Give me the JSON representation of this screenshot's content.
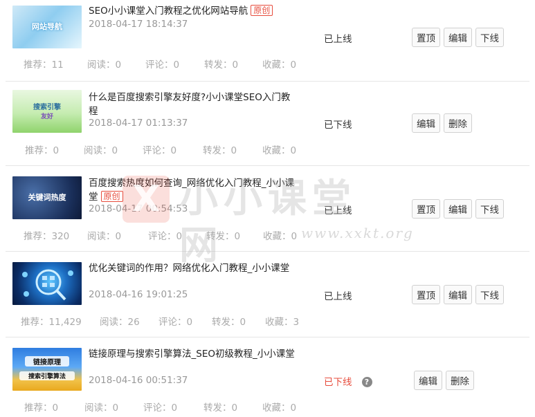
{
  "posts": [
    {
      "thumb_text": "网站导航",
      "title": "SEO小小课堂入门教程之优化网站导航",
      "tag": "原创",
      "date": "2018-04-17 18:14:37",
      "status": "已上线",
      "buttons": [
        "置顶",
        "编辑",
        "下线"
      ],
      "stats": {
        "recommend": "推荐：11",
        "read": "阅读：0",
        "comment": "评论：0",
        "share": "转发：0",
        "fav": "收藏：0"
      }
    },
    {
      "thumb_text": "搜索引擎",
      "thumb_sub": "友好",
      "title": "什么是百度搜索引擎友好度?小小课堂SEO入门教程",
      "tag": "",
      "date": "2018-04-17 01:13:37",
      "status": "已下线",
      "buttons": [
        "编辑",
        "删除"
      ],
      "stats": {
        "recommend": "推荐：0",
        "read": "阅读：0",
        "comment": "评论：0",
        "share": "转发：0",
        "fav": "收藏：0"
      }
    },
    {
      "thumb_text": "关键词热度",
      "title": "百度搜索热度如何查询_网络优化入门教程_小小课堂",
      "tag": "原创",
      "date": "2018-04-17 00:54:53",
      "status": "已上线",
      "buttons": [
        "置顶",
        "编辑",
        "下线"
      ],
      "stats": {
        "recommend": "推荐：320",
        "read": "阅读：0",
        "comment": "评论：0",
        "share": "转发：0",
        "fav": "收藏：0"
      }
    },
    {
      "thumb_text": "",
      "title": "优化关键词的作用？网络优化入门教程_小小课堂",
      "tag": "",
      "date": "2018-04-16 19:01:25",
      "status": "已上线",
      "buttons": [
        "置顶",
        "编辑",
        "下线"
      ],
      "stats": {
        "recommend": "推荐：11,429",
        "read": "阅读：26",
        "comment": "评论：0",
        "share": "转发：0",
        "fav": "收藏：3"
      }
    },
    {
      "thumb_text": "链接原理",
      "thumb_sub": "搜索引擎算法",
      "title": "链接原理与搜索引擎算法_SEO初级教程_小小课堂",
      "tag": "",
      "date": "2018-04-16 00:51:37",
      "status": "已下线",
      "status_color": "#e74c3c",
      "buttons": [
        "编辑",
        "删除"
      ],
      "stats": {
        "recommend": "推荐：0",
        "read": "阅读：0",
        "comment": "评论：0",
        "share": "转发：0",
        "fav": "收藏：0"
      }
    }
  ],
  "watermark": {
    "logo": "X",
    "text": "小小课堂网",
    "url": "www.xxkt.org"
  }
}
